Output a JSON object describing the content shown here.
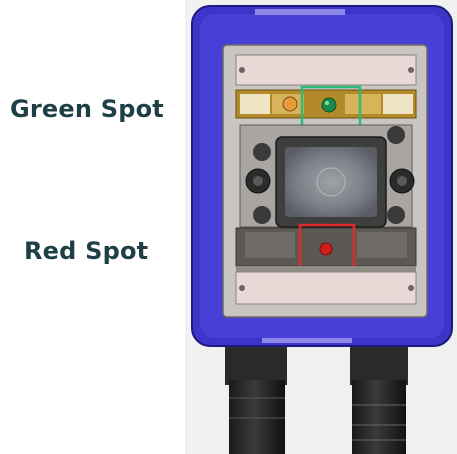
{
  "labels": {
    "green_spot": "Green Spot",
    "red_spot": "Red Spot"
  },
  "colors": {
    "label_text": "#1f3f46",
    "housing_blue": "#3b35c8",
    "housing_blue_dark": "#2a24a8",
    "faceplate": "#c9c6c2",
    "green_marker": "#2dbb7a",
    "red_marker": "#e02a2a",
    "green_led": "#1a8a4a",
    "red_led": "#d11d1d"
  },
  "icons": {
    "device": "camera-device-icon",
    "lens": "lens-icon"
  }
}
